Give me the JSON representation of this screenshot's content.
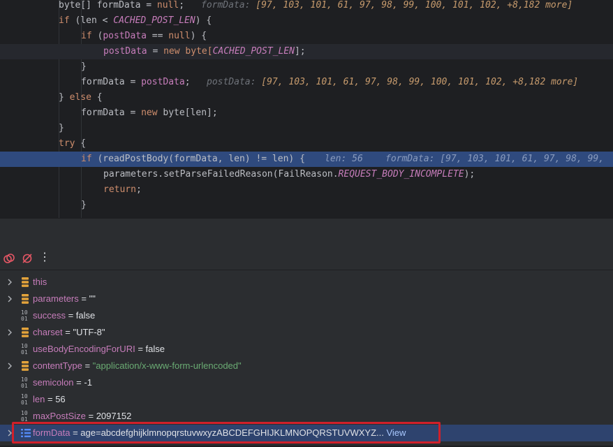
{
  "editor": {
    "lines": [
      {
        "kind": "plain"
      },
      {
        "kind": "plain"
      },
      {
        "kind": "current"
      },
      {
        "kind": "plain"
      },
      {
        "kind": "plain"
      },
      {
        "kind": "plain"
      },
      {
        "kind": "plain"
      },
      {
        "kind": "plain"
      },
      {
        "kind": "plain"
      },
      {
        "kind": "exec"
      },
      {
        "kind": "plain"
      },
      {
        "kind": "plain"
      },
      {
        "kind": "plain"
      }
    ],
    "t": {
      "l0_a": "byte[] formData = ",
      "l0_null": "null",
      "l0_b": ";",
      "l0_hint_label": "formData: ",
      "l0_hint_vals": "[97, 103, 101, 61, 97, 98, 99, 100, 101, 102, +8,182 more]",
      "l1_if": "if",
      "l1_a": " (len < ",
      "l1_const": "CACHED_POST_LEN",
      "l1_b": ") {",
      "l2_if": "if",
      "l2_a": " (",
      "l2_field": "postData",
      "l2_b": " == ",
      "l2_null": "null",
      "l2_c": ") {",
      "l3_field": "postData",
      "l3_a": " = ",
      "l3_new": "new",
      "l3_byte": " byte[",
      "l3_const": "CACHED_POST_LEN",
      "l3_b": "];",
      "l4": "}",
      "l5_a": "formData = ",
      "l5_field": "postData",
      "l5_b": ";",
      "l5_hint_label": "postData: ",
      "l5_hint_vals": "[97, 103, 101, 61, 97, 98, 99, 100, 101, 102, +8,182 more]",
      "l6_a": "} ",
      "l6_else": "else",
      "l6_b": " {",
      "l7_a": "formData = ",
      "l7_new": "new",
      "l7_b": " byte[len];",
      "l8": "}",
      "l9_try": "try",
      "l9_a": " {",
      "l10_if": "if",
      "l10_a": " (readPostBody(formData, len) != len) {",
      "l10_hint1": "len: 56",
      "l10_hint2": "formData: [97, 103, 101, 61, 97, 98, 99,",
      "l11_a": "parameters.setParseFailedReason(FailReason.",
      "l11_const": "REQUEST_BODY_INCOMPLETE",
      "l11_b": ");",
      "l12_ret": "return",
      "l12_b": ";",
      "l13": "}"
    }
  },
  "toolbar": {
    "icons": [
      "breakpoints-icon",
      "mute-breakpoints-icon",
      "more-options-icon"
    ],
    "more_glyph": "⋮"
  },
  "variables": [
    {
      "name": "this",
      "eq": "",
      "value": "",
      "type": "object",
      "expandable": true
    },
    {
      "name": "parameters",
      "eq": " = ",
      "value": "\"\"",
      "type": "object",
      "expandable": true
    },
    {
      "name": "success",
      "eq": " = ",
      "value": "false",
      "type": "primitive",
      "expandable": false
    },
    {
      "name": "charset",
      "eq": " = ",
      "value": "\"UTF-8\"",
      "type": "object",
      "expandable": true
    },
    {
      "name": "useBodyEncodingForURI",
      "eq": " = ",
      "value": "false",
      "type": "primitive",
      "expandable": false
    },
    {
      "name": "contentType",
      "eq": " = ",
      "value": "\"application/x-www-form-urlencoded\"",
      "type": "object-string",
      "expandable": true
    },
    {
      "name": "semicolon",
      "eq": " = ",
      "value": "-1",
      "type": "primitive",
      "expandable": false
    },
    {
      "name": "len",
      "eq": " = ",
      "value": "56",
      "type": "primitive",
      "expandable": false
    },
    {
      "name": "maxPostSize",
      "eq": " = ",
      "value": "2097152",
      "type": "primitive",
      "expandable": false
    },
    {
      "name": "formData",
      "eq": " = ",
      "value": "age=abcdefghijklmnopqrstuvwxyzABCDEFGHIJKLMNOPQRSTUVWXYZ...",
      "type": "array",
      "expandable": true,
      "link": "View",
      "selected": true
    }
  ],
  "primitive_icon_text": {
    "top": "10",
    "bottom": "01"
  },
  "colors": {
    "editor_bg": "#1e1f22",
    "panel_bg": "#2b2d30",
    "exec_line": "#2f4a7e",
    "selected_row": "#2e436e",
    "keyword": "#cf8e6d",
    "constant": "#c77dbb",
    "string": "#6aab73",
    "highlight_box": "#d0202a"
  }
}
